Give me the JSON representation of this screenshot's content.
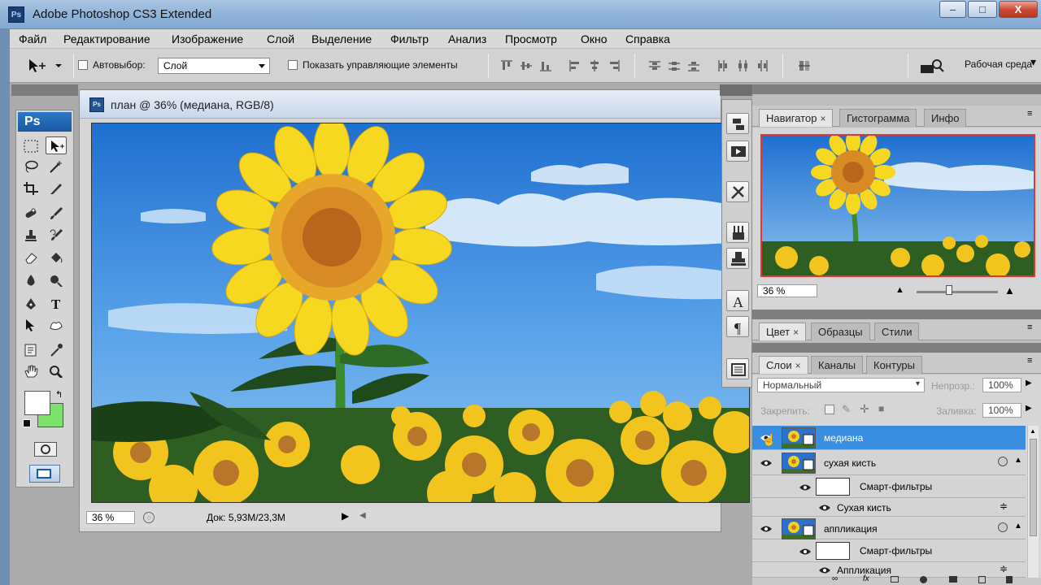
{
  "window": {
    "title": "Adobe Photoshop CS3 Extended",
    "app_icon": "Ps",
    "minimize_label": "–",
    "maximize_label": "□",
    "close_label": "X"
  },
  "menu": [
    "Файл",
    "Редактирование",
    "Изображение",
    "Слой",
    "Выделение",
    "Фильтр",
    "Анализ",
    "Просмотр",
    "Окно",
    "Справка"
  ],
  "options_bar": {
    "autoselect_label": "Автовыбор:",
    "autoselect_value": "Слой",
    "show_controls_label": "Показать управляющие элементы",
    "workspace_label": "Рабочая среда"
  },
  "tools": {
    "logo": "Ps",
    "items": [
      "marquee-tool",
      "move-tool",
      "lasso-tool",
      "magic-wand-tool",
      "crop-tool",
      "slice-tool",
      "healing-brush-tool",
      "brush-tool",
      "clone-stamp-tool",
      "history-brush-tool",
      "eraser-tool",
      "paint-bucket-tool",
      "blur-tool",
      "dodge-tool",
      "pen-tool",
      "type-tool",
      "path-selection-tool",
      "shape-tool",
      "notes-tool",
      "eyedropper-tool",
      "hand-tool",
      "zoom-tool"
    ],
    "foreground_color": "#ffffff",
    "background_color": "#7be26a"
  },
  "document": {
    "icon": "Ps",
    "title": "план @ 36% (медиана, RGB/8)",
    "zoom": "36 %",
    "doc_info": "Док: 5,93M/23,3M"
  },
  "navigator": {
    "tabs": [
      "Навигатор",
      "Гистограмма",
      "Инфо"
    ],
    "zoom": "36 %",
    "close_x": "×"
  },
  "color_panel": {
    "tabs": [
      "Цвет",
      "Образцы",
      "Стили"
    ]
  },
  "layers_panel": {
    "tabs": [
      "Слои",
      "Каналы",
      "Контуры"
    ],
    "blend_mode": "Нормальный",
    "opacity_label": "Непрозр.:",
    "opacity_value": "100%",
    "lock_label": "Закрепить:",
    "fill_label": "Заливка:",
    "fill_value": "100%",
    "layers": [
      {
        "name": "медиана",
        "selected": true
      },
      {
        "name": "сухая кисть",
        "selected": false
      },
      {
        "name": "Смарт-фильтры",
        "sub": true
      },
      {
        "name": "Сухая кисть",
        "subfilter": true
      },
      {
        "name": "аппликация",
        "selected": false
      },
      {
        "name": "Смарт-фильтры",
        "sub": true
      },
      {
        "name": "Аппликация",
        "subfilter": true
      }
    ]
  },
  "colors": {
    "accent": "#3a8ee0",
    "titlebar": "#8fb2d8",
    "navigator_frame": "#e0383a"
  }
}
